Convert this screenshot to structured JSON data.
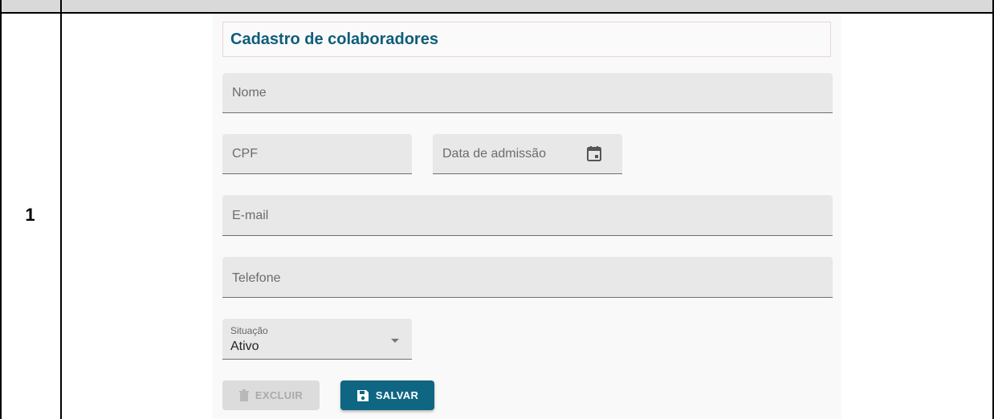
{
  "row": {
    "number": "1"
  },
  "form": {
    "title": "Cadastro de colaboradores",
    "fields": {
      "name": "Nome",
      "cpf": "CPF",
      "admission_date": "Data de admissão",
      "email": "E-mail",
      "phone": "Telefone",
      "status_label": "Situação",
      "status_value": "Ativo"
    },
    "buttons": {
      "delete": "EXCLUIR",
      "save": "SALVAR"
    }
  },
  "icons": {
    "calendar": "calendar-icon",
    "dropdown": "chevron-down-icon",
    "delete": "trash-icon",
    "save": "save-icon"
  },
  "colors": {
    "accent": "#0f6682",
    "title": "#0f5d7a",
    "field_bg": "#e8e8e8"
  }
}
